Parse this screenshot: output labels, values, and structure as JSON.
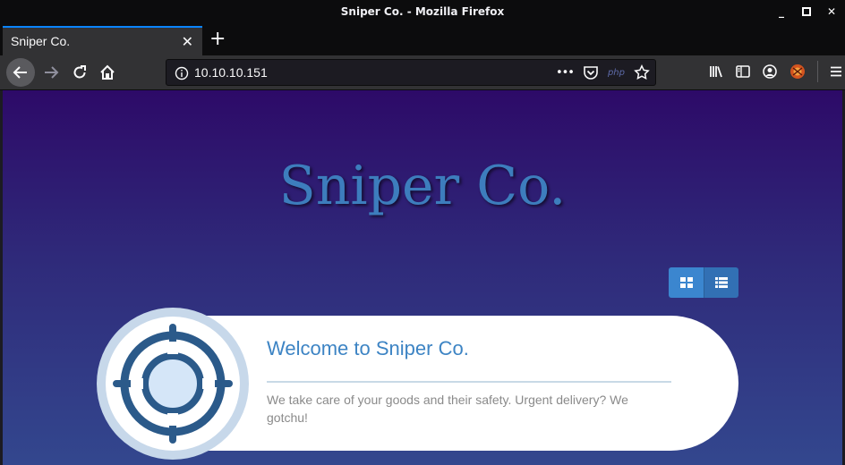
{
  "window": {
    "title": "Sniper Co. - Mozilla Firefox"
  },
  "tab": {
    "title": "Sniper Co.",
    "close_label": "✕",
    "new_tab_label": "+"
  },
  "urlbar": {
    "url": "10.10.10.151",
    "more_label": "•••",
    "php_label": "php"
  },
  "page": {
    "hero_title": "Sniper Co.",
    "card": {
      "title": "Welcome to Sniper Co.",
      "text": "We take care of your goods and their safety. Urgent delivery? We gotchu!"
    }
  },
  "colors": {
    "accent": "#3d84c4",
    "toggle": "#3b86cf",
    "background_top": "#2d0a68",
    "background_bottom": "#33478e"
  },
  "icons": [
    "back-icon",
    "forward-icon",
    "reload-icon",
    "home-icon",
    "info-icon",
    "pocket-icon",
    "star-icon",
    "library-icon",
    "sidebar-icon",
    "account-icon",
    "extension-icon",
    "menu-icon",
    "grid-icon",
    "list-icon",
    "crosshair-icon"
  ]
}
